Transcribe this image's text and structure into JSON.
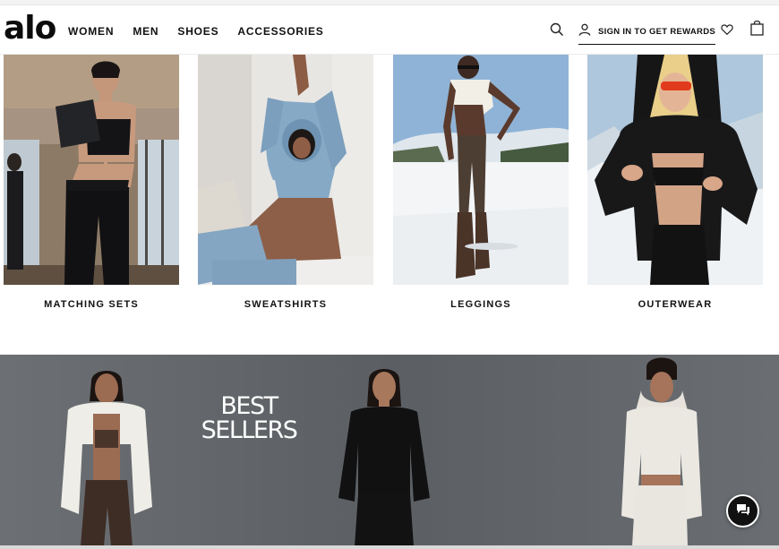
{
  "brand": {
    "logo_text": "alo"
  },
  "nav": {
    "items": [
      {
        "label": "WOMEN"
      },
      {
        "label": "MEN"
      },
      {
        "label": "SHOES"
      },
      {
        "label": "ACCESSORIES"
      }
    ]
  },
  "header": {
    "signin_label": "SIGN IN TO GET REWARDS",
    "icons": {
      "search": "search-icon",
      "user": "user-icon",
      "wishlist": "heart-icon",
      "bag": "shopping-bag-icon"
    }
  },
  "categories": [
    {
      "label": "MATCHING SETS"
    },
    {
      "label": "SWEATSHIRTS"
    },
    {
      "label": "LEGGINGS"
    },
    {
      "label": "OUTERWEAR"
    }
  ],
  "banner": {
    "line1": "BEST",
    "line2": "SELLERS"
  },
  "chat": {
    "icon": "chat-icon"
  },
  "colors": {
    "text": "#111111",
    "banner_bg": "#62666a",
    "white": "#ffffff"
  }
}
